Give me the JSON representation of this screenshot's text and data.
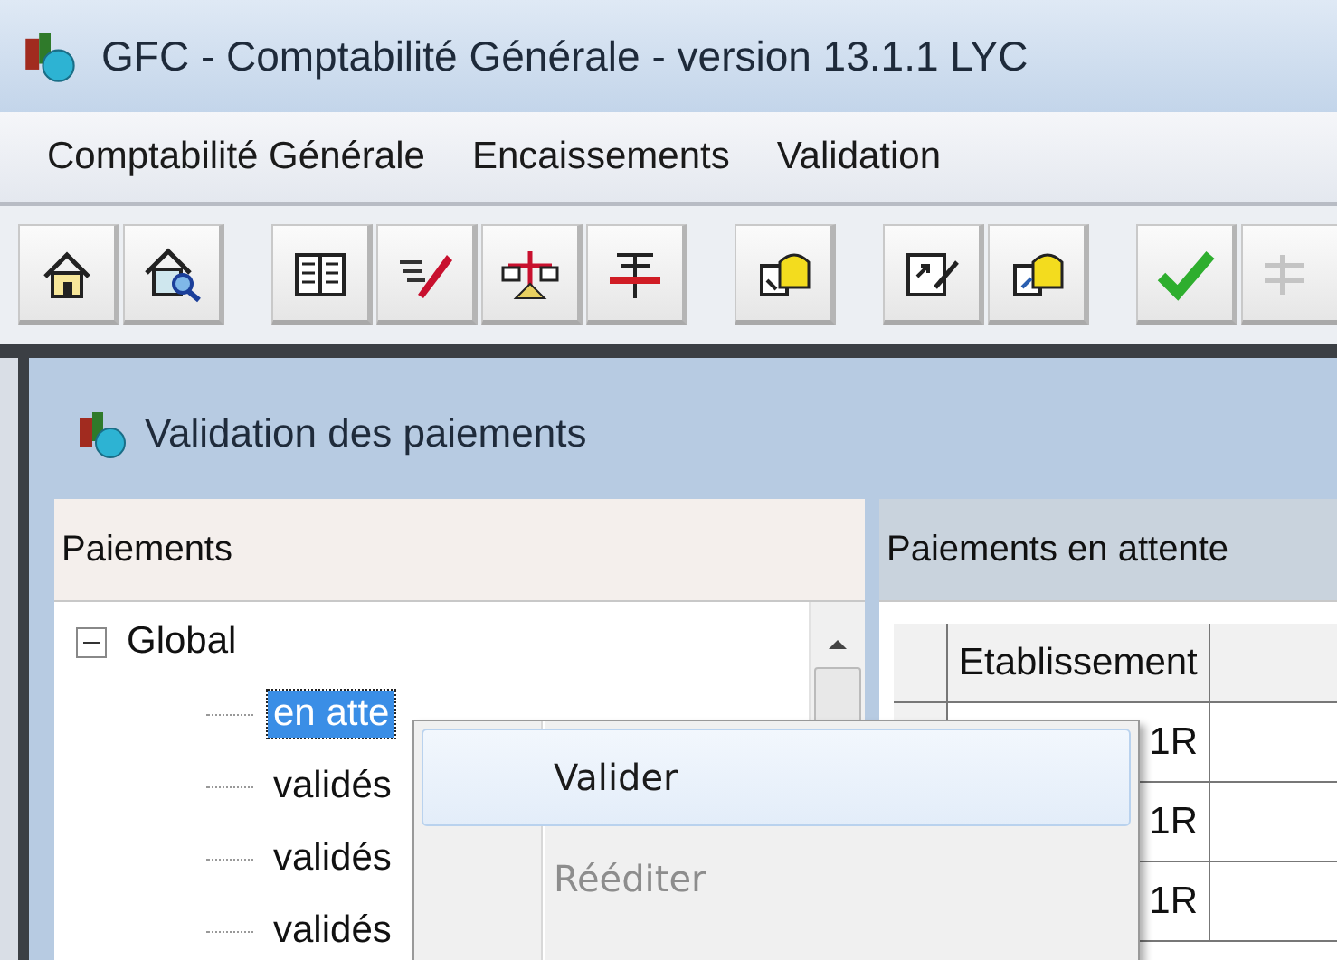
{
  "window": {
    "title": "GFC - Comptabilité Générale - version 13.1.1  LYC"
  },
  "menu_bar": [
    "Comptabilité Générale",
    "Encaissements",
    "Validation"
  ],
  "child_window": {
    "title": "Validation des paiements"
  },
  "left_panel": {
    "header": "Paiements",
    "tree": [
      {
        "label": "Global",
        "expanded": true,
        "children": [
          {
            "label": "en atte",
            "selected": true
          },
          {
            "label": "validés",
            "selected": false
          },
          {
            "label": "validés",
            "selected": false
          },
          {
            "label": "validés",
            "selected": false
          }
        ]
      }
    ]
  },
  "right_panel": {
    "header": "Paiements en attente",
    "table": {
      "columns": [
        "Etablissement"
      ],
      "rows": [
        {
          "cells": [
            "1R"
          ]
        },
        {
          "cells": [
            "1R"
          ]
        },
        {
          "cells": [
            "1R"
          ]
        }
      ]
    }
  },
  "context_menu": [
    {
      "label": "Valider",
      "selected": true,
      "disabled": false
    },
    {
      "label": "Rééditer",
      "selected": false,
      "disabled": true
    }
  ]
}
